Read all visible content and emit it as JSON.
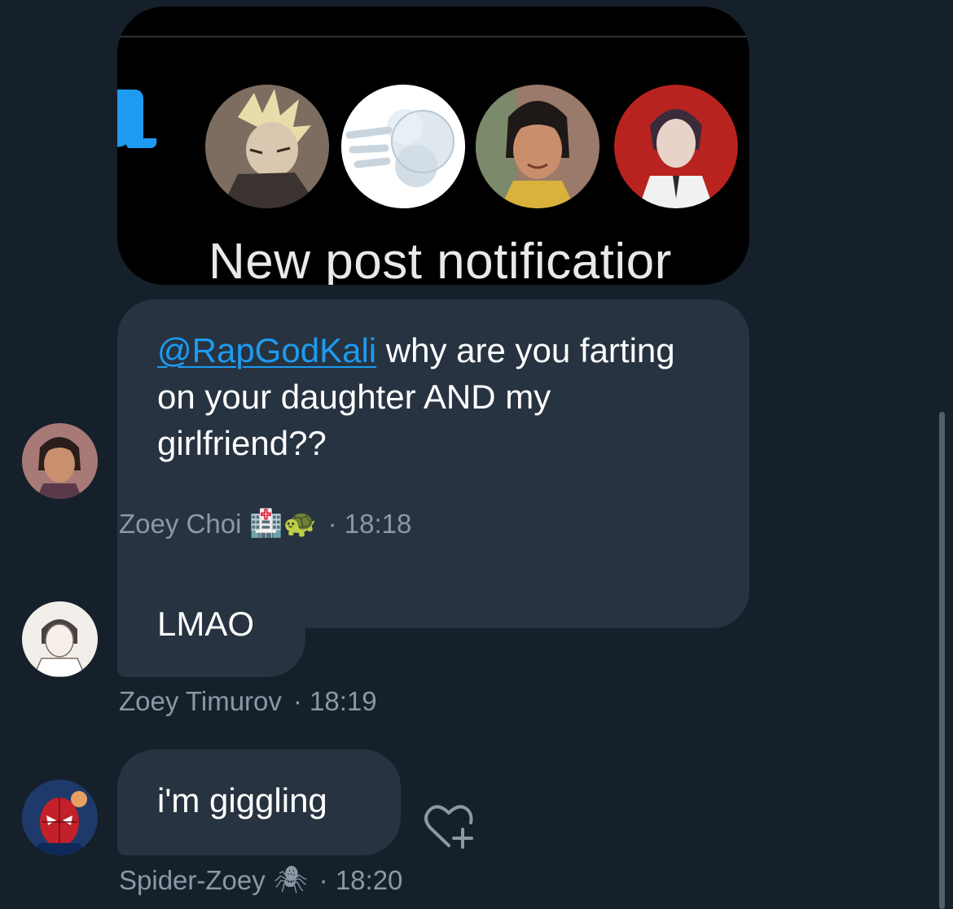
{
  "shared_image": {
    "caption": "New post notificatior"
  },
  "messages": [
    {
      "mention": "@RapGodKali",
      "text": " why are you farting on your daughter AND my girlfriend??",
      "author": "Zoey Choi",
      "author_emoji": "🏥🐢",
      "time": "· 18:18"
    },
    {
      "text": "LMAO",
      "author": "Zoey Timurov",
      "time": "· 18:19"
    },
    {
      "text": "i'm giggling",
      "author": "Spider-Zoey",
      "author_emoji": "🕷",
      "time": "· 18:20"
    }
  ],
  "icons": {
    "bell": "bell-icon",
    "react": "heart-plus-icon"
  },
  "colors": {
    "background": "#15202b",
    "bubble": "#273340",
    "mention": "#1d9bf0",
    "meta_text": "#8b98a5"
  }
}
